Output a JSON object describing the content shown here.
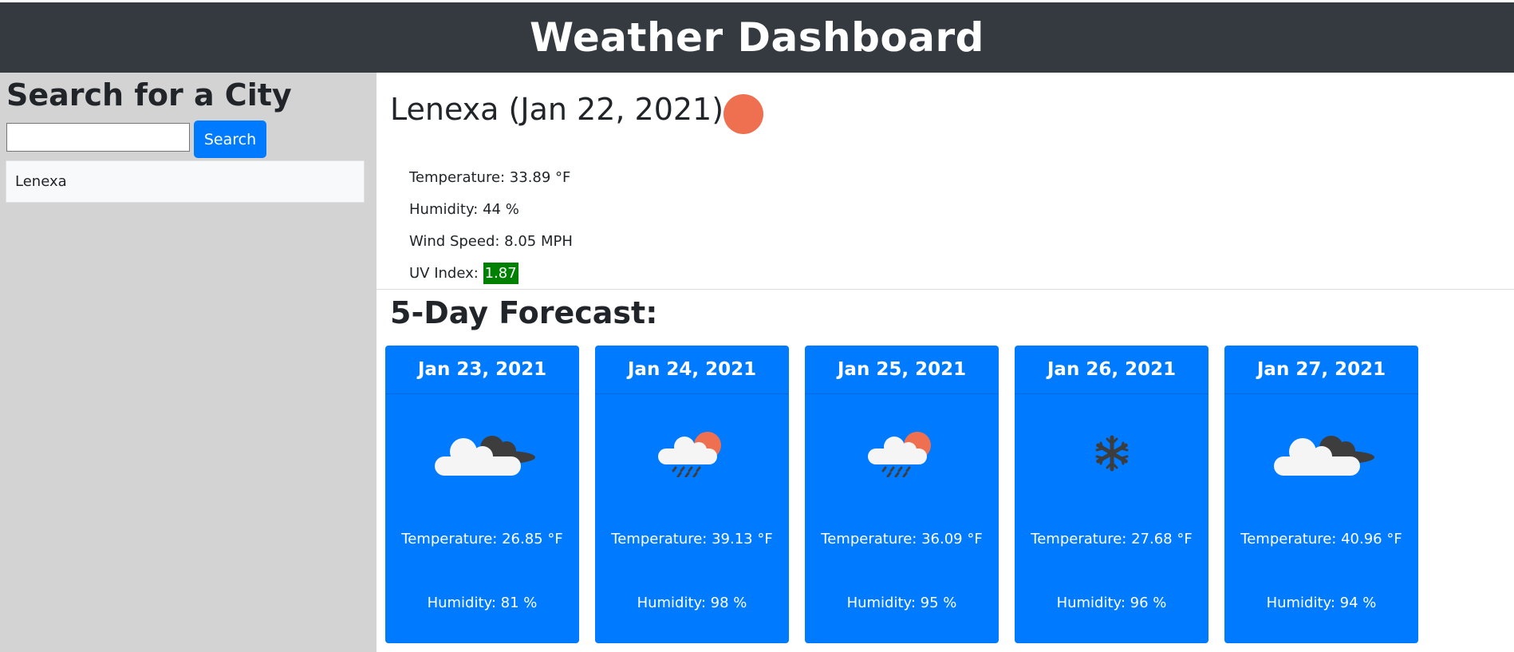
{
  "header": {
    "title": "Weather Dashboard"
  },
  "sidebar": {
    "heading": "Search for a City",
    "search": {
      "value": "",
      "placeholder": "",
      "button_label": "Search"
    },
    "history": [
      "Lenexa"
    ]
  },
  "current": {
    "title": "Lenexa (Jan 22, 2021)",
    "icon": "sun-icon",
    "temperature": "Temperature: 33.89 °F",
    "humidity": "Humidity: 44 %",
    "wind": "Wind Speed: 8.05 MPH",
    "uv_label": "UV Index: ",
    "uv_value": "1.87",
    "uv_color": "#008000"
  },
  "forecast": {
    "heading": "5-Day Forecast:",
    "days": [
      {
        "date": "Jan 23, 2021",
        "icon": "cloudy-icon",
        "temperature": "Temperature: 26.85 °F",
        "humidity": "Humidity: 81 %"
      },
      {
        "date": "Jan 24, 2021",
        "icon": "rain-sun-icon",
        "temperature": "Temperature: 39.13 °F",
        "humidity": "Humidity: 98 %"
      },
      {
        "date": "Jan 25, 2021",
        "icon": "rain-sun-icon",
        "temperature": "Temperature: 36.09 °F",
        "humidity": "Humidity: 95 %"
      },
      {
        "date": "Jan 26, 2021",
        "icon": "snowflake-icon",
        "temperature": "Temperature: 27.68 °F",
        "humidity": "Humidity: 96 %"
      },
      {
        "date": "Jan 27, 2021",
        "icon": "cloudy-icon",
        "temperature": "Temperature: 40.96 °F",
        "humidity": "Humidity: 94 %"
      }
    ]
  },
  "colors": {
    "header": "#343a40",
    "accent": "#007bff",
    "sidebar": "#d3d3d3",
    "sun": "#ef7050"
  }
}
